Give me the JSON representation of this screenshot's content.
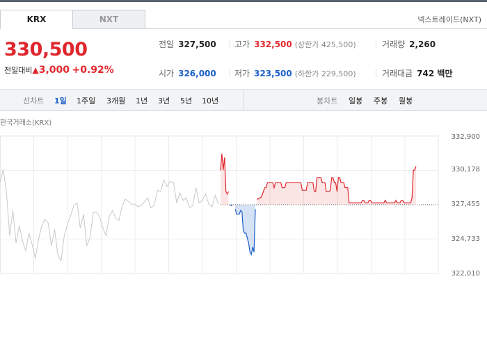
{
  "tabs": {
    "krx": "KRX",
    "nxt": "NXT"
  },
  "nxt_link": "넥스트레이드(NXT)",
  "price": "330,500",
  "change": {
    "label": "전일대비",
    "arrow": "▲",
    "amount": "3,000",
    "percent": "+0.92%"
  },
  "stats": {
    "prev_close": {
      "label": "전일",
      "value": "327,500"
    },
    "high": {
      "label": "고가",
      "value": "332,500",
      "sub": "(상한가 425,500)"
    },
    "volume": {
      "label": "거래량",
      "value": "2,260"
    },
    "open": {
      "label": "시가",
      "value": "326,000"
    },
    "low": {
      "label": "저가",
      "value": "323,500",
      "sub": "(하한가 229,500)"
    },
    "amount": {
      "label": "거래대금",
      "value": "742 백만"
    }
  },
  "chartbar": {
    "line_label": "선차트",
    "periods": [
      "1일",
      "1주일",
      "3개월",
      "1년",
      "3년",
      "5년",
      "10년"
    ],
    "active_period": "1일",
    "candle_label": "봉차트",
    "candles": [
      "일봉",
      "주봉",
      "월봉"
    ]
  },
  "exchange_label": "한국거래소(KRX)",
  "colors": {
    "up": "#e0262d",
    "down": "#1a5fc7",
    "grey": "#c8c8c8"
  },
  "chart_data": {
    "type": "line",
    "ylim": [
      322010,
      332900
    ],
    "yticks": [
      "332,900",
      "330,178",
      "327,455",
      "324,733",
      "322,010"
    ],
    "baseline": 327455,
    "grey_series": [
      329200,
      330250,
      328500,
      325000,
      327000,
      324400,
      325800,
      324600,
      323800,
      325200,
      324300,
      323200,
      324700,
      325800,
      326300,
      326000,
      324200,
      325500,
      323500,
      323000,
      325000,
      325900,
      326600,
      327400,
      327600,
      325600,
      326700,
      324200,
      324800,
      326800,
      326900,
      326500,
      325600,
      325000,
      326500,
      327000,
      326400,
      326200,
      327300,
      327900,
      327700,
      327500,
      327500,
      327300,
      327400,
      327700,
      328000,
      327200,
      327400,
      328600,
      328500,
      329400,
      328900,
      329300,
      329200,
      327600,
      328400,
      327800,
      328000,
      327200,
      327400,
      328800,
      327600,
      327800,
      328300,
      327500,
      327300,
      328200,
      327500
    ],
    "day_series": [
      330178,
      331500,
      330200,
      331200,
      328500,
      328300,
      328500,
      327400,
      327400,
      327400,
      327600,
      327100,
      326700,
      326700,
      326700,
      327000,
      326900,
      325400,
      325200,
      325200,
      324800,
      324400,
      323700,
      323500,
      324100,
      323700,
      327100,
      327900,
      327900,
      328000,
      328000,
      328200,
      328500,
      328800,
      328800,
      329200,
      329200,
      329200,
      329200,
      329200,
      328800,
      329200,
      329200,
      329200,
      329200,
      329200,
      328800,
      328800,
      328800,
      329200,
      329200,
      329200,
      329200,
      329200,
      329200,
      329200,
      329200,
      329200,
      329200,
      329200,
      329200,
      328600,
      328600,
      328600,
      328600,
      329200,
      329200,
      329200,
      329200,
      329200,
      328500,
      328500,
      329600,
      329600,
      329600,
      329600,
      329200,
      329200,
      329200,
      328500,
      328500,
      328500,
      328600,
      329600,
      329600,
      329200,
      329200,
      328500,
      329600,
      329600,
      329200,
      329200,
      329200,
      328800,
      328800,
      328800,
      327600,
      327600,
      327600,
      327600,
      327600,
      327600,
      327600,
      327600,
      327600,
      327600,
      327800,
      327800,
      327600,
      327600,
      327600,
      327800,
      327800,
      327600,
      327600,
      327600,
      327600,
      327600,
      327600,
      327600,
      327600,
      327600,
      327600,
      327800,
      327600,
      327600,
      327600,
      327600,
      327600,
      327600,
      327600,
      327800,
      327600,
      327600,
      327600,
      327800,
      327800,
      327600,
      327600,
      327600,
      327600,
      327600,
      327600,
      328000,
      330200,
      330200,
      330500
    ]
  }
}
